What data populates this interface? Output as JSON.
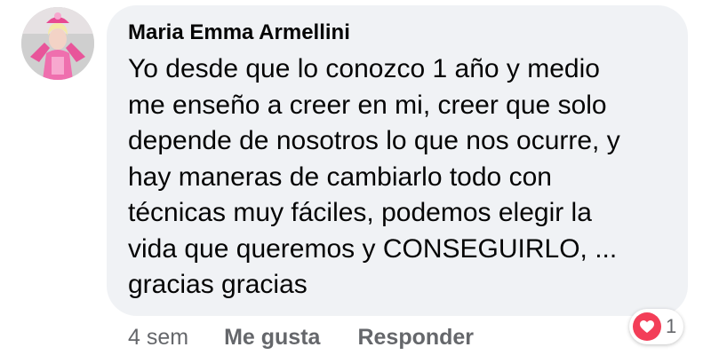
{
  "comment": {
    "author": "Maria Emma Armellini",
    "text": "Yo desde que lo conozco 1 año y medio\nme enseño a creer en mi, creer que solo\ndepende de nosotros lo que nos ocurre, y\nhay maneras de cambiarlo todo con\ntécnicas muy fáciles, podemos elegir la\nvida que queremos y CONSEGUIRLO, ...\ngracias gracias",
    "time": "4 sem",
    "like_label": "Me gusta",
    "reply_label": "Responder",
    "reaction": {
      "icon": "love-reaction-icon",
      "color": "#f33e58",
      "count": "1"
    }
  },
  "colors": {
    "bubble": "#f0f2f5",
    "text": "#050505",
    "secondary": "#65676b"
  }
}
